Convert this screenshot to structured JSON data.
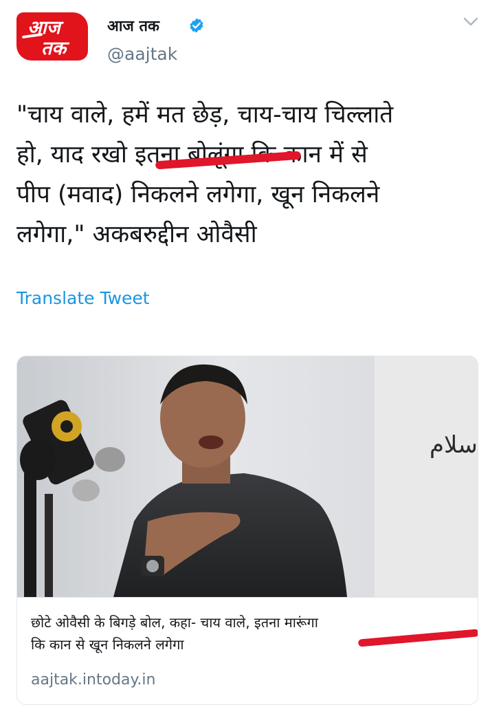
{
  "account": {
    "logo_text_top": "आज",
    "logo_text_bottom": "तक",
    "display_name": "आज तक",
    "verified": true,
    "handle": "@aajtak"
  },
  "tweet": {
    "text_lines": [
      "\"चाय वाले, हमें मत छेड़, चाय-चाय चिल्लाते",
      "हो, याद रखो इतना बोलूंगा कि कान में से",
      "पीप (मवाद) निकलने लगेगा, खून निकलने",
      "लगेगा,\" अकबरुद्दीन ओवैसी"
    ],
    "translate_label": "Translate Tweet"
  },
  "card": {
    "image_text": "سلام",
    "title_lines": [
      "छोटे ओवैसी के बिगड़े बोल, कहा- चाय वाले, इतना मारूंगा",
      "कि कान से खून निकलने लगेगा"
    ],
    "domain": "aajtak.intoday.in"
  },
  "colors": {
    "brand_red": "#e1131b",
    "link_blue": "#1b95e0",
    "verified_blue": "#1da1f2",
    "annotation_red": "#e0162b"
  },
  "icons": {
    "menu": "chevron-down-icon",
    "verified": "verified-icon"
  }
}
